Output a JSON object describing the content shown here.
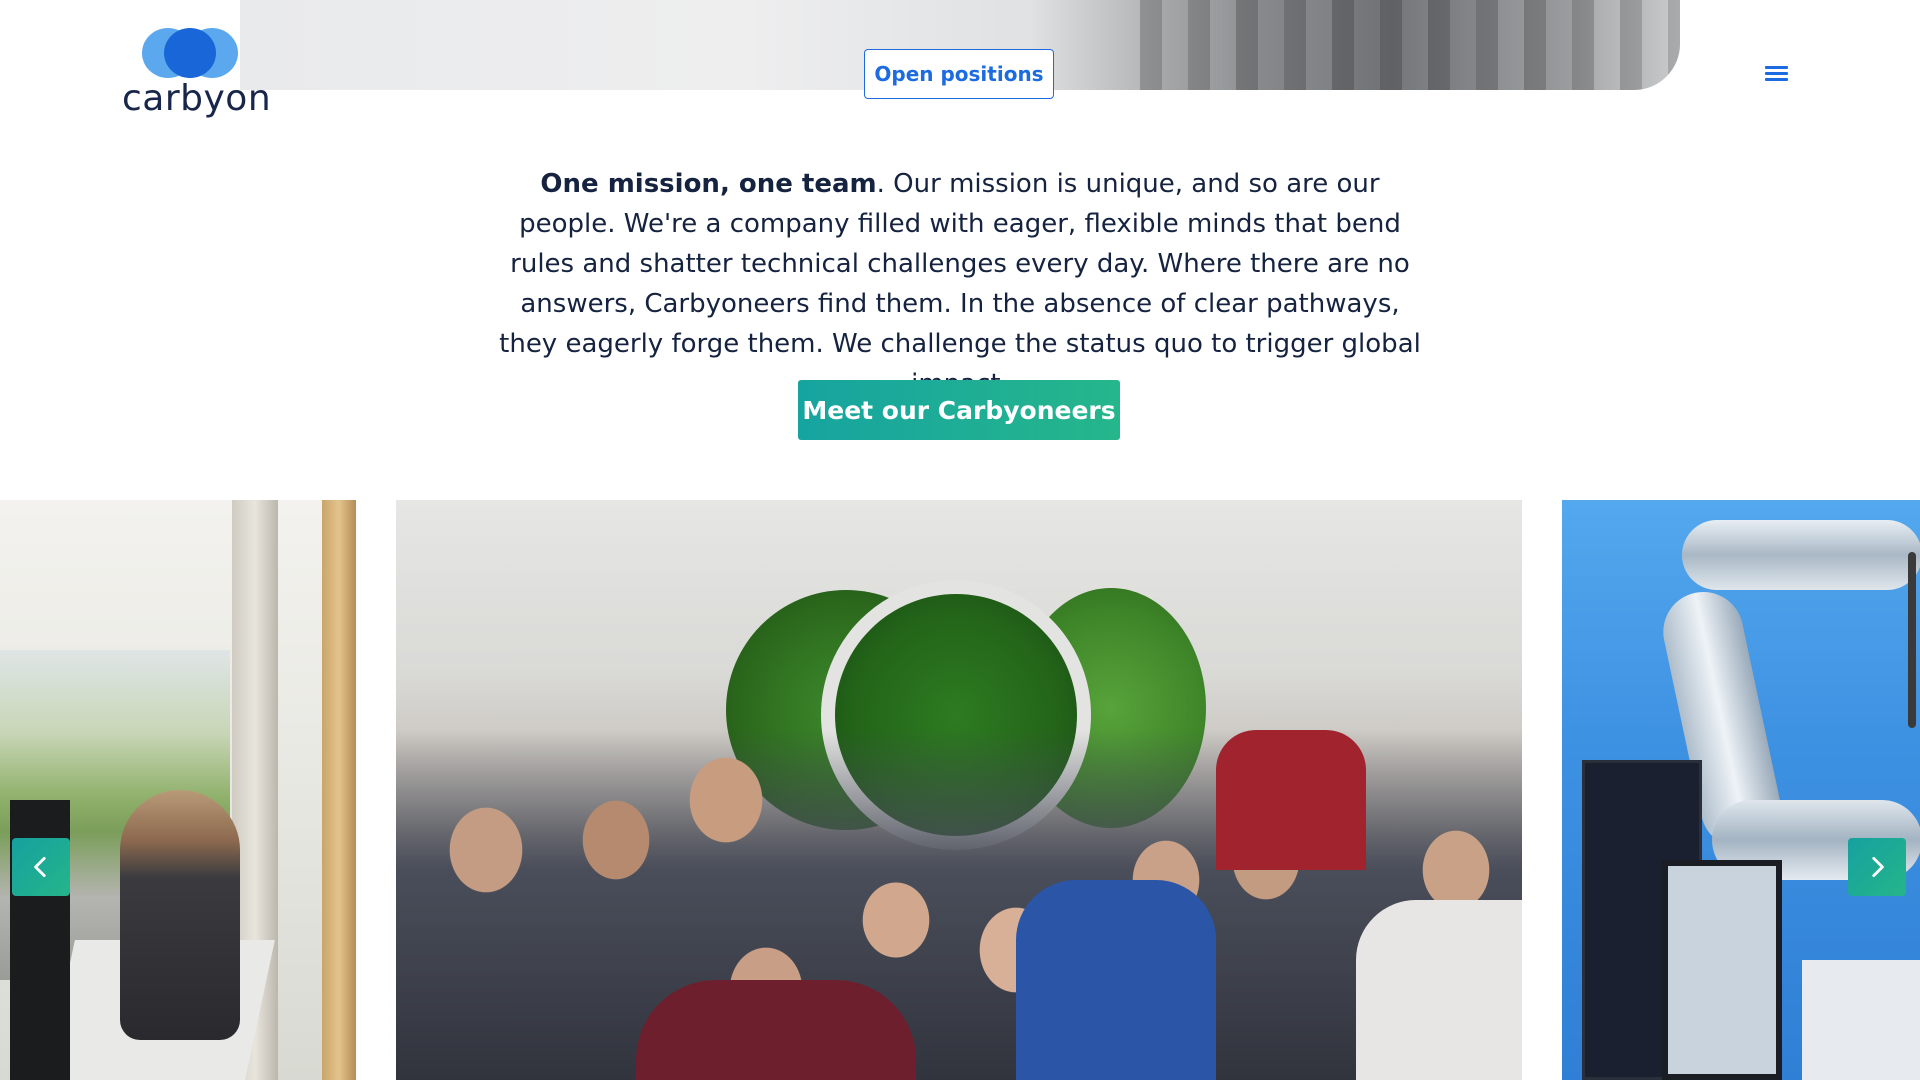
{
  "header": {
    "logo_text": "carbyon",
    "open_positions_label": "Open positions",
    "menu_icon": "hamburger-icon"
  },
  "intro": {
    "lead_bold": "One mission, one team",
    "body": ". Our mission is unique, and so are our people. We're a company filled with eager, flexible minds that bend rules and shatter technical challenges every day. Where there are no answers, Carbyoneers find them. In the absence of clear pathways, they eagerly forge them. We challenge the status quo to trigger global impact."
  },
  "cta": {
    "label": "Meet our Carbyoneers"
  },
  "carousel": {
    "prev_icon": "chevron-left-icon",
    "next_icon": "chevron-right-icon"
  },
  "colors": {
    "brand_blue": "#1d6be0",
    "brand_green": "#16a4a0",
    "text_dark": "#152340"
  }
}
